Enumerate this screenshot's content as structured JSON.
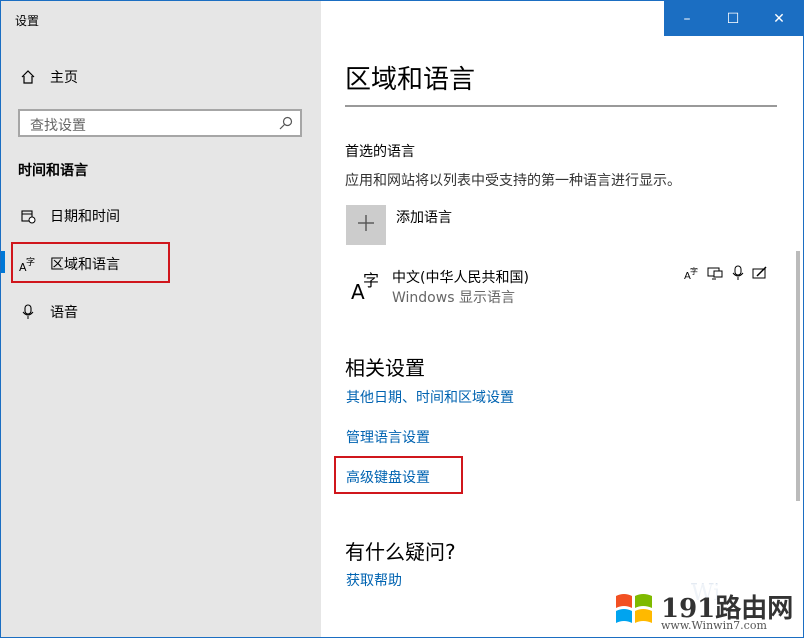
{
  "window": {
    "title": "设置",
    "minimize": "–",
    "maximize": "☐",
    "close": "✕"
  },
  "sidebar": {
    "home": {
      "icon": "home-icon",
      "label": "主页"
    },
    "search": {
      "placeholder": "查找设置",
      "icon": "search-icon"
    },
    "section_title": "时间和语言",
    "items": [
      {
        "icon": "calendar-clock-icon",
        "label": "日期和时间",
        "selected": false
      },
      {
        "icon": "language-icon",
        "label": "区域和语言",
        "selected": true
      },
      {
        "icon": "microphone-icon",
        "label": "语音",
        "selected": false
      }
    ]
  },
  "main": {
    "title": "区域和语言",
    "preferred": {
      "heading": "首选的语言",
      "description": "应用和网站将以列表中受支持的第一种语言进行显示。",
      "add_label": "添加语言",
      "add_icon": "plus-icon",
      "language": {
        "name": "中文(中华人民共和国)",
        "subtitle": "Windows 显示语言",
        "icon_text": "A字",
        "features": [
          "language-pack-icon",
          "display-icon",
          "speech-icon",
          "handwriting-icon"
        ]
      }
    },
    "related": {
      "heading": "相关设置",
      "links": [
        "其他日期、时间和区域设置",
        "管理语言设置",
        "高级键盘设置"
      ]
    },
    "questions": {
      "heading": "有什么疑问?",
      "link": "获取帮助"
    }
  },
  "watermark": {
    "brand": "191路由网",
    "url": "www.Winwin7.com",
    "faint": "Wi"
  },
  "colors": {
    "accent": "#0078d7",
    "link": "#0063b1",
    "highlight": "#d0161c",
    "titlebar": "#1b6ec2"
  }
}
